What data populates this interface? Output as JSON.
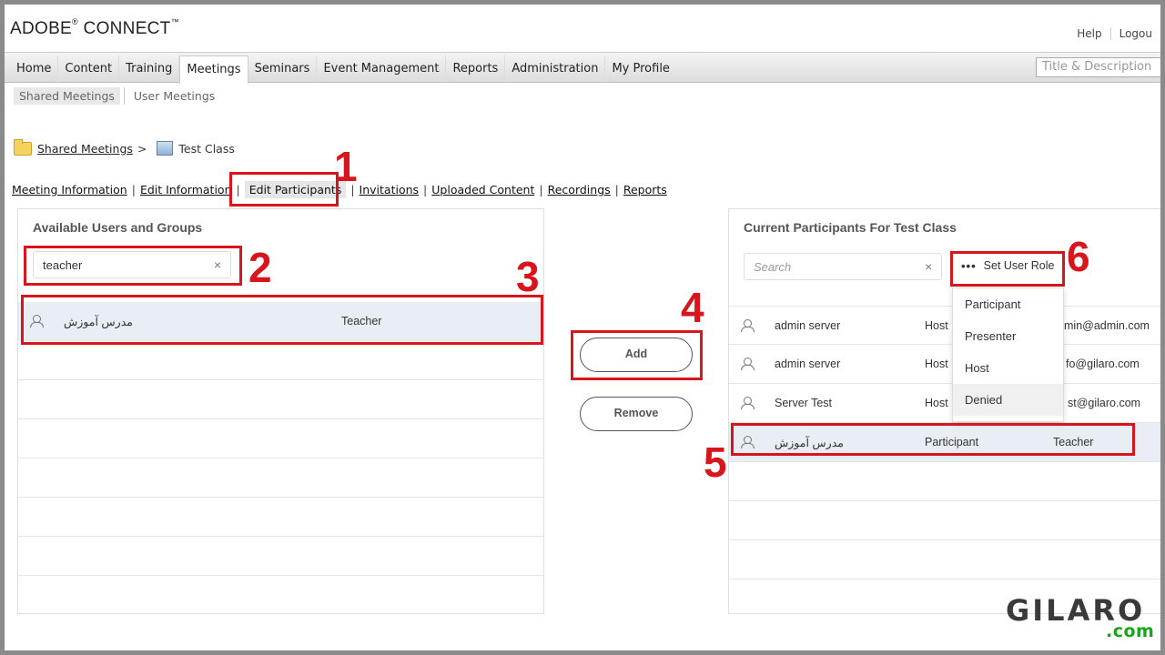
{
  "app": {
    "logo": "ADOBE",
    "logo_mark": "®",
    "logo_rest": " CONNECT",
    "logo_tm": "™",
    "help": "Help",
    "logout": "Logou"
  },
  "nav": {
    "items": [
      "Home",
      "Content",
      "Training",
      "Meetings",
      "Seminars",
      "Event Management",
      "Reports",
      "Administration",
      "My Profile"
    ],
    "active": "Meetings",
    "search_placeholder": "Title & Description"
  },
  "subnav": {
    "shared": "Shared Meetings",
    "user": "User Meetings"
  },
  "breadcrumb": {
    "root": "Shared Meetings",
    "sep": ">",
    "current": "Test Class"
  },
  "tabs": [
    "Meeting Information",
    "Edit Information",
    "Edit Participants",
    "Invitations",
    "Uploaded Content",
    "Recordings",
    "Reports"
  ],
  "available": {
    "title": "Available Users and Groups",
    "search_value": "teacher",
    "clear_icon": "×",
    "rows": [
      {
        "name": "مدرس آموزش",
        "login": "Teacher"
      }
    ]
  },
  "actions": {
    "add": "Add",
    "remove": "Remove"
  },
  "current": {
    "title": "Current Participants For Test Class",
    "search_placeholder": "Search",
    "clear_icon": "×",
    "role_button": "Set User Role",
    "role_dots": "•••",
    "role_options": [
      "Participant",
      "Presenter",
      "Host",
      "Denied"
    ],
    "rows": [
      {
        "name": "admin server",
        "role": "Host",
        "email": "admin@admin.com",
        "visible_email": "min@admin.com"
      },
      {
        "name": "admin server",
        "role": "Host",
        "email": "info@gilaro.com",
        "visible_email": "fo@gilaro.com"
      },
      {
        "name": "Server Test",
        "role": "Host",
        "email": "test@gilaro.com",
        "visible_email": "st@gilaro.com"
      },
      {
        "name": "مدرس آموزش",
        "role": "Participant",
        "email": "Teacher",
        "visible_email": "Teacher"
      }
    ]
  },
  "annotations": [
    "1",
    "2",
    "3",
    "4",
    "5",
    "6"
  ],
  "watermark": {
    "brand": "GILARO",
    "domain": ".com"
  },
  "colors": {
    "highlight": "#d8141c",
    "watermark_green": "#1aa51a"
  }
}
